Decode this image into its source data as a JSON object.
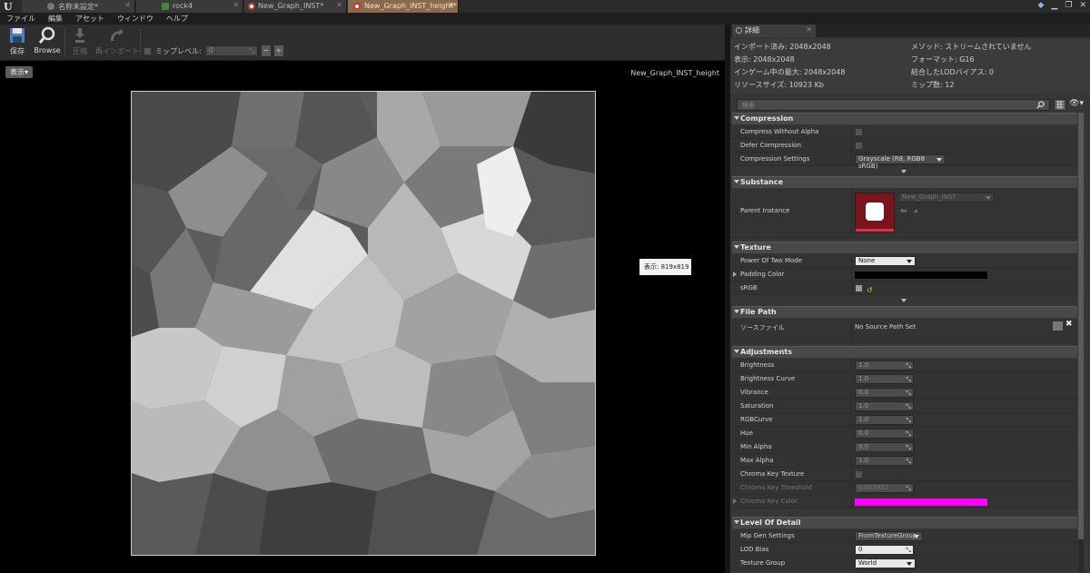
{
  "tabs": [
    {
      "label": "名称未設定*",
      "active": false
    },
    {
      "label": "rock4",
      "active": false
    },
    {
      "label": "New_Graph_INST*",
      "active": false
    },
    {
      "label": "New_Graph_INST_height*",
      "active": true
    }
  ],
  "menu": [
    "ファイル",
    "編集",
    "アセット",
    "ウィンドウ",
    "ヘルプ"
  ],
  "toolbar": {
    "save_label": "保存",
    "browse_label": "Browse",
    "compress_label": "圧縮",
    "reimport_label": "再インポート",
    "mip_label": "ミップレベル:",
    "mip_value": "0",
    "minus": "−",
    "plus": "+"
  },
  "viewport": {
    "view_button": "表示▾",
    "asset_name": "New_Graph_INST_height",
    "size_tooltip": "表示: 819x819"
  },
  "details": {
    "tab_label": "詳細",
    "info": {
      "imported": "インポート済み: 2048x2048",
      "displayed": "表示: 2048x2048",
      "max_ingame": "インゲーム中の最大: 2048x2048",
      "resource_size": "リソースサイズ: 10923 Kb",
      "method": "メソッド: ストリームされていません",
      "format": "フォーマット: G16",
      "lod_bias": "結合したLODバイアス: 0",
      "mip_count": "ミップ数: 12"
    },
    "search_placeholder": "検索",
    "sections": {
      "compression": "Compression",
      "substance": "Substance",
      "texture": "Texture",
      "file_path": "File Path",
      "adjustments": "Adjustments",
      "lod": "Level Of Detail"
    },
    "compression": {
      "compress_without_alpha": "Compress Without Alpha",
      "defer_compression": "Defer Compression",
      "compression_settings": "Compression Settings",
      "compression_settings_value": "Grayscale (R8, RGB8 sRGB)"
    },
    "substance": {
      "parent_instance": "Parent Instance",
      "parent_value": "New_Graph_INST"
    },
    "texture": {
      "power_of_two": "Power Of Two Mode",
      "power_of_two_value": "None",
      "padding_color": "Padding Color",
      "srgb": "sRGB"
    },
    "file_path": {
      "source_label": "ソースファイル",
      "source_value": "No Source Path Set"
    },
    "adjustments": [
      {
        "label": "Brightness",
        "value": "1.0"
      },
      {
        "label": "Brightness Curve",
        "value": "1.0"
      },
      {
        "label": "Vibrance",
        "value": "0.0"
      },
      {
        "label": "Saturation",
        "value": "1.0"
      },
      {
        "label": "RGBCurve",
        "value": "1.0"
      },
      {
        "label": "Hue",
        "value": "0.0"
      },
      {
        "label": "Min Alpha",
        "value": "0.0"
      },
      {
        "label": "Max Alpha",
        "value": "1.0"
      }
    ],
    "chroma": {
      "key_texture": "Chroma Key Texture",
      "threshold": "Chroma Key Threshold",
      "threshold_value": "0.003922",
      "color": "Chroma Key Color"
    },
    "lod": {
      "mip_gen": "Mip Gen Settings",
      "mip_gen_value": "FromTextureGroup",
      "lod_bias": "LOD Bias",
      "lod_bias_value": "0",
      "texture_group": "Texture Group",
      "texture_group_value": "World"
    }
  },
  "colors": {
    "accent_tab": "#8a6a4a",
    "padding_color": "#000000",
    "chroma_key_color": "#ff00ff",
    "substance_red": "#8a1a22"
  }
}
